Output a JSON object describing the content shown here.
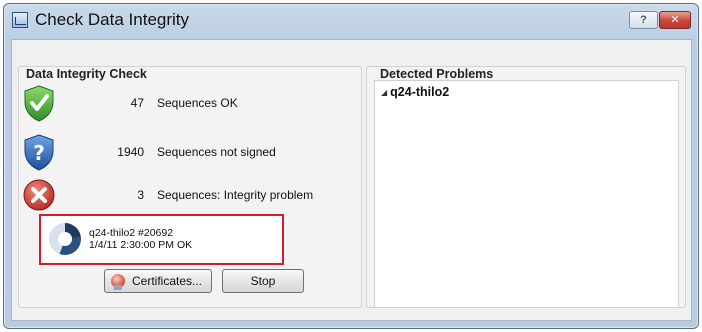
{
  "window": {
    "title": "Check Data Integrity",
    "help_label": "?",
    "close_label": "✕"
  },
  "left_group": {
    "title": "Data Integrity Check",
    "stats": [
      {
        "icon": "shield-check-icon",
        "count": "47",
        "label": "Sequences OK",
        "color": "#3a9a3a"
      },
      {
        "icon": "shield-question-icon",
        "count": "1940",
        "label": "Sequences not signed",
        "color": "#2c6fbf"
      },
      {
        "icon": "error-x-icon",
        "count": "3",
        "label": "Sequences: Integrity problem",
        "color": "#c8312a"
      }
    ],
    "progress": {
      "line1": "q24-thilo2 #20692",
      "line2": "1/4/11 2:30:00 PM OK"
    },
    "buttons": {
      "certificates_label": "Certificates...",
      "stop_label": "Stop"
    }
  },
  "right_group": {
    "title": "Detected Problems",
    "tree": [
      {
        "label": "q24-thilo2",
        "expanded": true
      }
    ]
  },
  "colors": {
    "highlight_border": "#d01f2a",
    "title_bar": "#c9daea"
  }
}
